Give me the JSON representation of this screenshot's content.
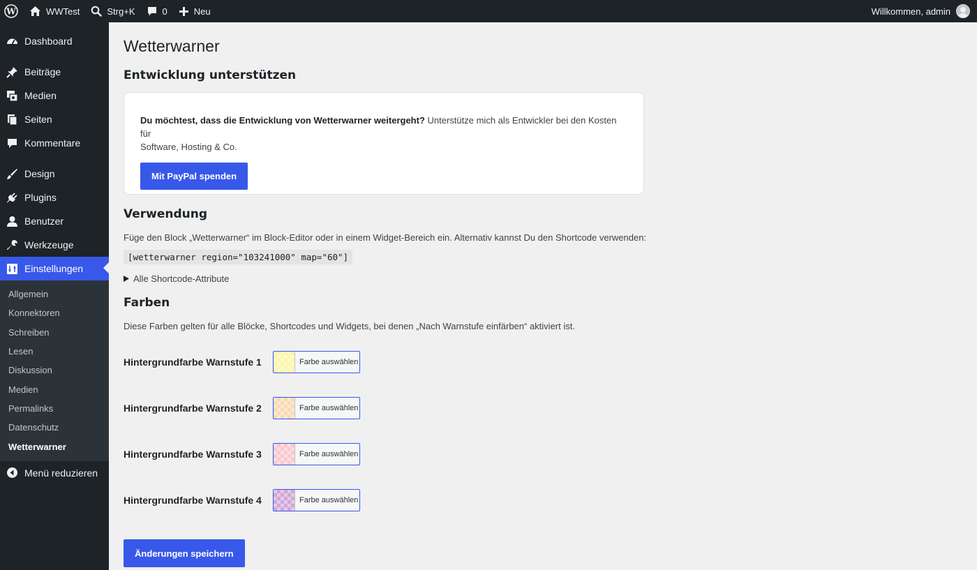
{
  "adminbar": {
    "site_name": "WWTest",
    "search_shortcut": "Strg+K",
    "comments_count": "0",
    "new_label": "Neu",
    "welcome": "Willkommen, admin"
  },
  "sidebar": {
    "items": [
      {
        "label": "Dashboard",
        "icon": "dashboard-icon"
      },
      {
        "label": "Beiträge",
        "icon": "pin-icon"
      },
      {
        "label": "Medien",
        "icon": "media-icon"
      },
      {
        "label": "Seiten",
        "icon": "pages-icon"
      },
      {
        "label": "Kommentare",
        "icon": "comment-icon"
      },
      {
        "label": "Design",
        "icon": "brush-icon"
      },
      {
        "label": "Plugins",
        "icon": "plugin-icon"
      },
      {
        "label": "Benutzer",
        "icon": "user-icon"
      },
      {
        "label": "Werkzeuge",
        "icon": "wrench-icon"
      },
      {
        "label": "Einstellungen",
        "icon": "settings-icon"
      }
    ],
    "submenu": [
      "Allgemein",
      "Konnektoren",
      "Schreiben",
      "Lesen",
      "Diskussion",
      "Medien",
      "Permalinks",
      "Datenschutz",
      "Wetterwarner"
    ],
    "collapse_label": "Menü reduzieren"
  },
  "main": {
    "title": "Wetterwarner",
    "support": {
      "heading": "Entwicklung unterstützen",
      "bold_text": "Du möchtest, dass die Entwicklung von Wetterwarner weitergeht?",
      "text_line1": " Unterstütze mich als Entwickler bei den Kosten für",
      "text_line2": "Software, Hosting & Co.",
      "button": "Mit PayPal spenden"
    },
    "usage": {
      "heading": "Verwendung",
      "text": "Füge den Block „Wetterwarner“ im Block-Editor oder in einem Widget-Bereich ein. Alternativ kannst Du den Shortcode verwenden:",
      "shortcode": "[wetterwarner region=\"103241000\" map=\"60\"]",
      "details": "Alle Shortcode-Attribute"
    },
    "colors": {
      "heading": "Farben",
      "text": "Diese Farben gelten für alle Blöcke, Shortcodes und Widgets, bei denen „Nach Warnstufe einfärben“ aktiviert ist.",
      "button_label": "Farbe auswählen",
      "rows": [
        {
          "label": "Hintergrundfarbe Warnstufe 1",
          "color": "#fdf6a8"
        },
        {
          "label": "Hintergrundfarbe Warnstufe 2",
          "color": "#fcd9b4"
        },
        {
          "label": "Hintergrundfarbe Warnstufe 3",
          "color": "#fbc7cd"
        },
        {
          "label": "Hintergrundfarbe Warnstufe 4",
          "color": "#d2a6d8"
        }
      ]
    },
    "save_button": "Änderungen speichern"
  }
}
